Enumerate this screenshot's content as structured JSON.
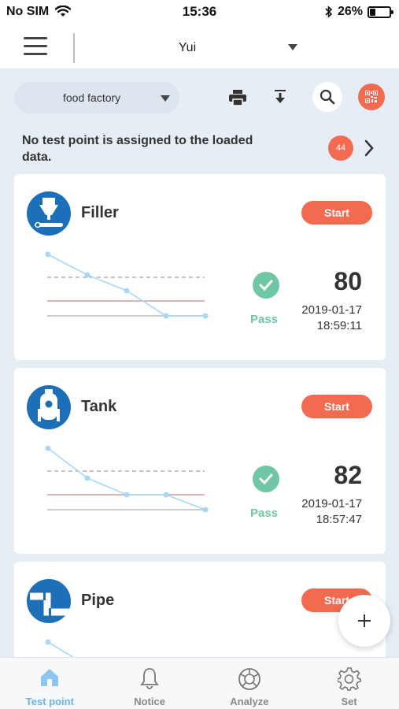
{
  "status_bar": {
    "carrier": "No SIM",
    "time": "15:36",
    "battery": "26%",
    "battery_level": 0.26
  },
  "header": {
    "user": "Yui"
  },
  "toolbar": {
    "factory": "food factory"
  },
  "notice": {
    "text": "No test point is assigned to the loaded data.",
    "count": "44"
  },
  "colors": {
    "accent": "#f26a4f",
    "pass": "#6fc7a3",
    "brand_blue": "#1d6fb8",
    "active_nav": "#6cb4e8"
  },
  "cards": [
    {
      "title": "Filler",
      "icon": "filler-icon",
      "start": "Start",
      "status": "Pass",
      "score": "80",
      "date": "2019-01-17",
      "time": "18:59:11"
    },
    {
      "title": "Tank",
      "icon": "tank-icon",
      "start": "Start",
      "status": "Pass",
      "score": "82",
      "date": "2019-01-17",
      "time": "18:57:47"
    },
    {
      "title": "Pipe",
      "icon": "pipe-icon",
      "start": "Start"
    }
  ],
  "nav": [
    {
      "label": "Test point",
      "icon": "home-icon"
    },
    {
      "label": "Notice",
      "icon": "bell-icon"
    },
    {
      "label": "Analyze",
      "icon": "analyze-icon"
    },
    {
      "label": "Set",
      "icon": "gear-icon"
    }
  ]
}
